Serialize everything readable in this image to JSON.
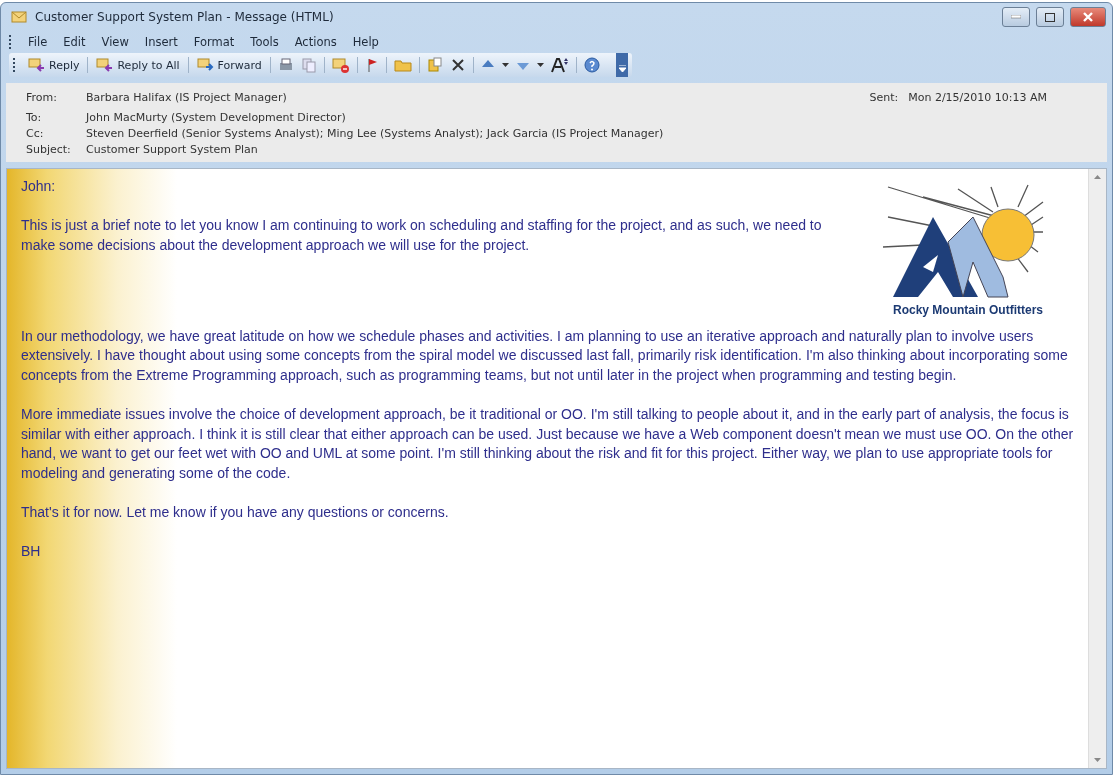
{
  "window": {
    "title": "Customer Support System Plan - Message (HTML)"
  },
  "menu": [
    "File",
    "Edit",
    "View",
    "Insert",
    "Format",
    "Tools",
    "Actions",
    "Help"
  ],
  "toolbar": [
    {
      "label": "Reply"
    },
    {
      "label": "Reply to All"
    },
    {
      "label": "Forward"
    }
  ],
  "header": {
    "from_label": "From:",
    "from": "Barbara Halifax (IS Project Manager)",
    "sent_label": "Sent:",
    "sent": "Mon 2/15/2010 10:13 AM",
    "to_label": "To:",
    "to": "John MacMurty (System Development Director)",
    "cc_label": "Cc:",
    "cc": "Steven Deerfield (Senior Systems Analyst); Ming Lee (Systems Analyst); Jack Garcia (IS Project Manager)",
    "subject_label": "Subject:",
    "subject": "Customer Support System Plan"
  },
  "logo": {
    "text": "Rocky Mountain Outfitters"
  },
  "body": [
    "John:",
    "This is just a brief note to let you know I am continuing to work on scheduling and staffing for the project, and as such, we need to make some decisions about the development approach we will use for the project.",
    "In our methodology, we have great latitude on how we schedule phases and activities.  I am planning to use an iterative approach and naturally plan to involve users extensively.  I have thought about using some concepts from the spiral model we discussed last fall, primarily risk identification.  I'm also thinking about incorporating some concepts from the Extreme Programming approach, such as programming teams, but not until later in the project when programming and testing begin.",
    "More immediate issues involve the choice of development approach, be it traditional or OO.  I'm still talking to people about it, and in the early part of analysis, the focus is similar with either approach.  I think it is still clear that either approach can be used.  Just because we have a Web component doesn't mean we must use OO.  On the other hand, we want to get our feet wet with OO and UML at some point.  I'm still thinking about the risk and fit for this project.  Either way, we plan to use appropriate tools for modeling and generating some of the code.",
    "That's it for now.  Let me know if you have any questions or concerns.",
    "BH"
  ]
}
